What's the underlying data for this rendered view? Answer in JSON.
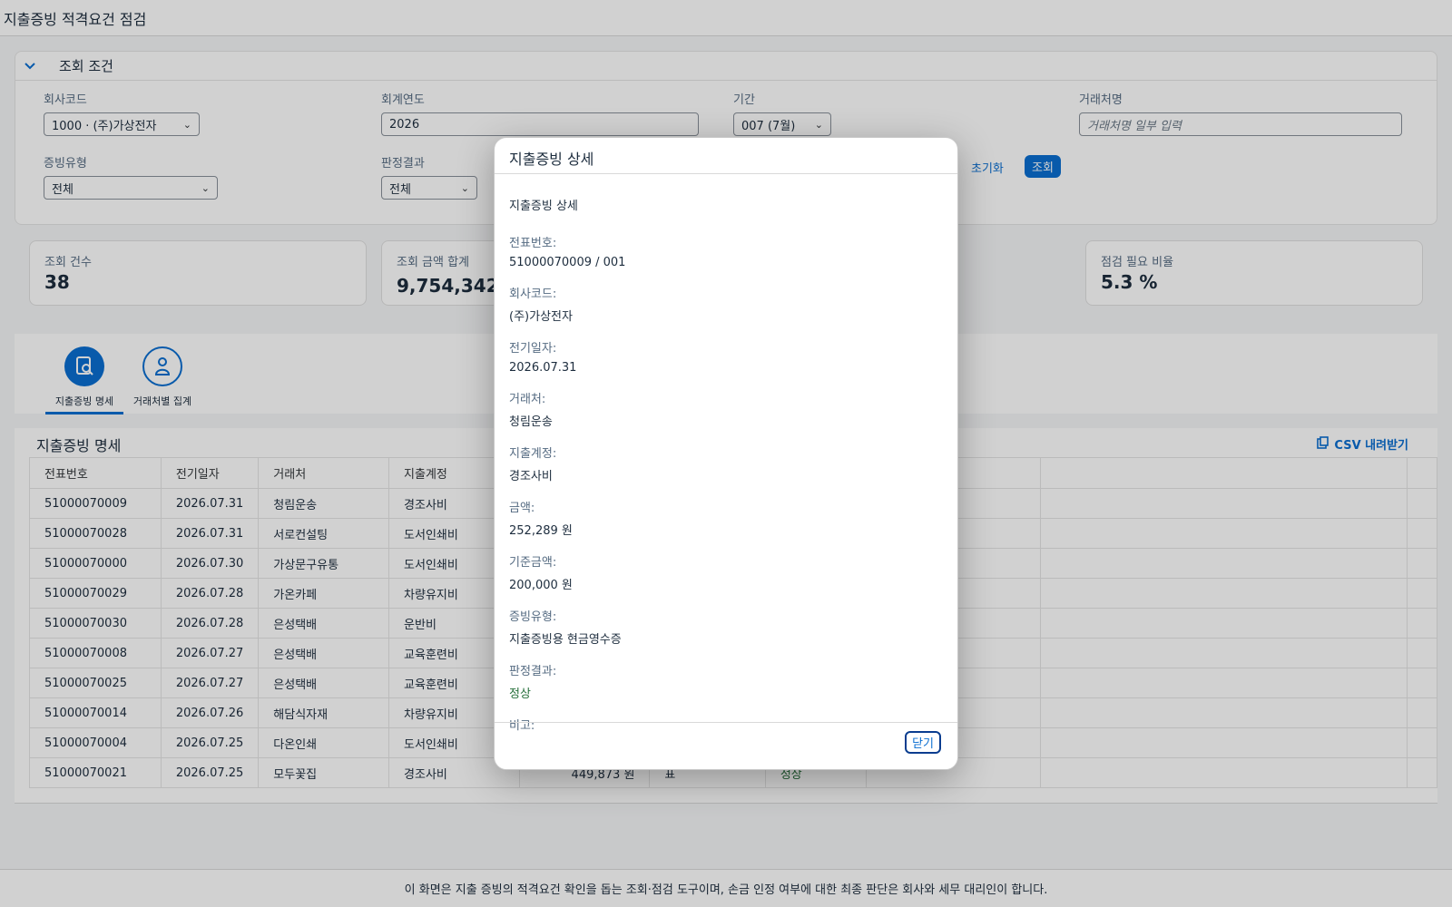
{
  "app": {
    "title": "지출증빙 적격요건 점검"
  },
  "filter": {
    "section_title": "조회 조건",
    "company": {
      "label": "회사코드",
      "value": "1000 · (주)가상전자"
    },
    "year": {
      "label": "회계연도",
      "value": "2026"
    },
    "period": {
      "label": "기간",
      "value": "007 (7월)"
    },
    "vendor": {
      "label": "거래처명",
      "placeholder": "거래처명 일부 입력"
    },
    "proof_type": {
      "label": "증빙유형",
      "value": "전체"
    },
    "result": {
      "label": "판정결과",
      "value": "전체"
    },
    "reset_label": "초기화",
    "search_label": "조회"
  },
  "kpis": [
    {
      "label": "조회 건수",
      "value": "38"
    },
    {
      "label": "조회 금액 합계",
      "value": "9,754,342 원"
    },
    {
      "label": "점검 필요 비율",
      "value": "5.3 %"
    }
  ],
  "tabs": [
    {
      "label": "지출증빙 명세",
      "icon": "document-search-icon",
      "selected": true
    },
    {
      "label": "거래처별 집계",
      "icon": "person-icon",
      "selected": false
    }
  ],
  "table": {
    "title": "지출증빙 명세",
    "csv_label": "CSV 내려받기",
    "columns": [
      "전표번호",
      "전기일자",
      "거래처",
      "지출계정"
    ],
    "rows": [
      [
        "51000070009",
        "2026.07.31",
        "청림운송",
        "경조사비"
      ],
      [
        "51000070028",
        "2026.07.31",
        "서로컨설팅",
        "도서인쇄비"
      ],
      [
        "51000070000",
        "2026.07.30",
        "가상문구유통",
        "도서인쇄비"
      ],
      [
        "51000070029",
        "2026.07.28",
        "가온카페",
        "차량유지비"
      ],
      [
        "51000070030",
        "2026.07.28",
        "은성택배",
        "운반비"
      ],
      [
        "51000070008",
        "2026.07.27",
        "은성택배",
        "교육훈련비"
      ],
      [
        "51000070025",
        "2026.07.27",
        "은성택배",
        "교육훈련비"
      ],
      [
        "51000070014",
        "2026.07.26",
        "해담식자재",
        "차량유지비"
      ],
      [
        "51000070004",
        "2026.07.25",
        "다온인쇄",
        "도서인쇄비"
      ],
      [
        "51000070021",
        "2026.07.25",
        "모두꽃집",
        "경조사비"
      ]
    ],
    "last_row_partial": {
      "amount": "449,873 원",
      "proof": "표",
      "result": "정상"
    }
  },
  "footer": {
    "text": "이 화면은 지출 증빙의 적격요건 확인을 돕는 조회·점검 도구이며, 손금 인정 여부에 대한 최종 판단은 회사와 세무 대리인이 합니다."
  },
  "dialog": {
    "title": "지출증빙 상세",
    "subtitle": "지출증빙 상세",
    "fields": [
      {
        "label": "전표번호:",
        "value": "51000070009 / 001"
      },
      {
        "label": "회사코드:",
        "value": "(주)가상전자"
      },
      {
        "label": "전기일자:",
        "value": "2026.07.31"
      },
      {
        "label": "거래처:",
        "value": "청림운송"
      },
      {
        "label": "지출계정:",
        "value": "경조사비"
      },
      {
        "label": "금액:",
        "value": "252,289 원"
      },
      {
        "label": "기준금액:",
        "value": "200,000 원"
      },
      {
        "label": "증빙유형:",
        "value": "지출증빙용 현금영수증"
      },
      {
        "label": "판정결과:",
        "value": "정상"
      },
      {
        "label": "비고:",
        "value": ""
      }
    ],
    "close_label": "닫기"
  }
}
